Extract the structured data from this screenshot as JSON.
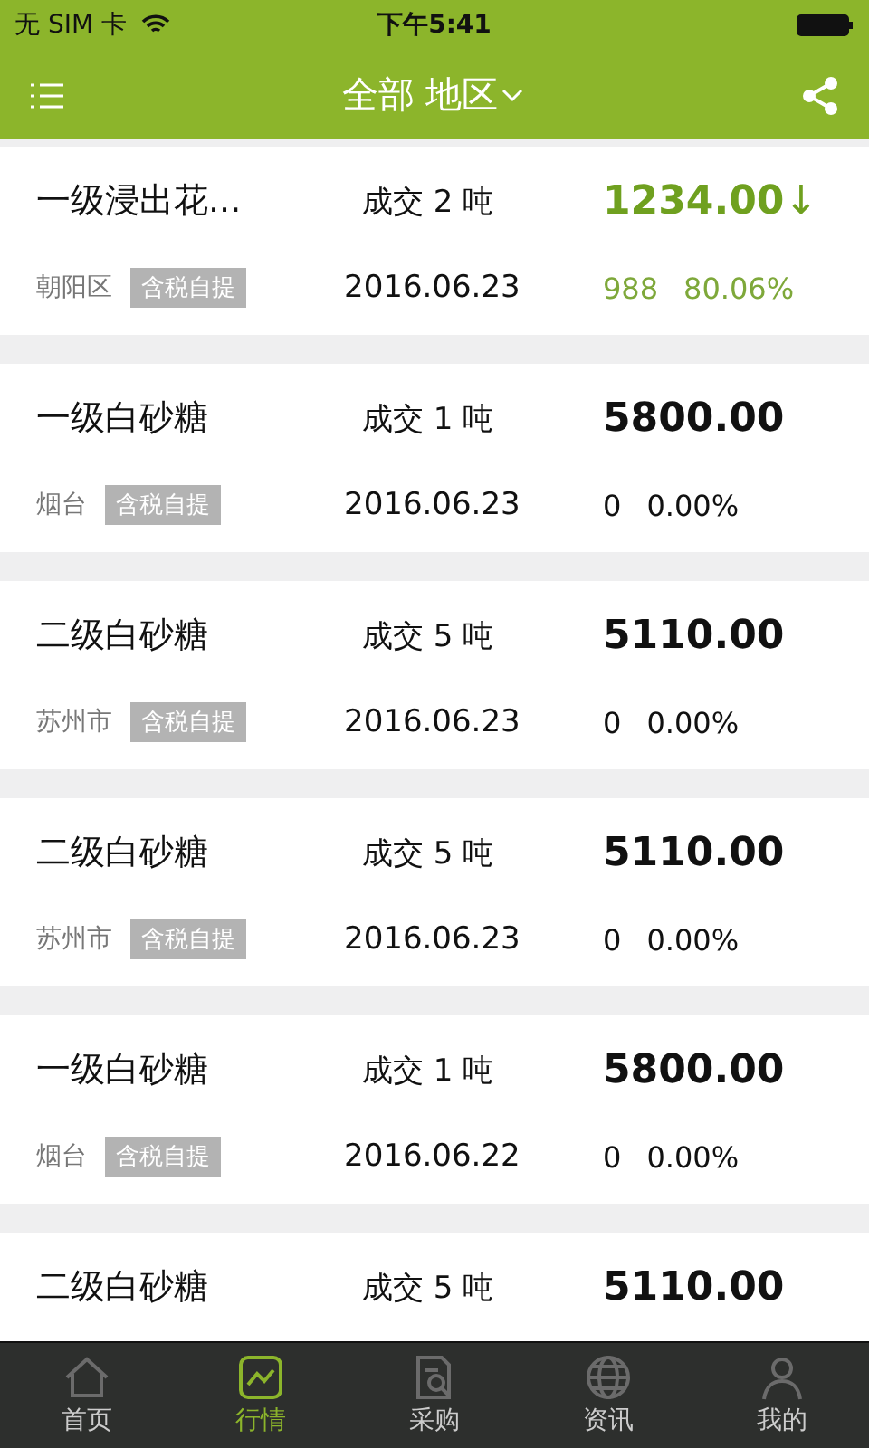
{
  "status_bar": {
    "carrier": "无 SIM 卡",
    "time": "下午5:41"
  },
  "header": {
    "title": "全部 地区"
  },
  "quotes": [
    {
      "name": "一级浸出花...",
      "volume": "成交 2 吨",
      "price": "1234.00",
      "arrow": "↓",
      "kind": "down",
      "region": "朝阳区",
      "tag": "含税自提",
      "date": "2016.06.23",
      "change": "988",
      "percent": "80.06%"
    },
    {
      "name": "一级白砂糖",
      "volume": "成交 1 吨",
      "price": "5800.00",
      "kind": "flat",
      "region": "烟台",
      "tag": "含税自提",
      "date": "2016.06.23",
      "change": "0",
      "percent": "0.00%"
    },
    {
      "name": "二级白砂糖",
      "volume": "成交 5 吨",
      "price": "5110.00",
      "kind": "flat",
      "region": "苏州市",
      "tag": "含税自提",
      "date": "2016.06.23",
      "change": "0",
      "percent": "0.00%"
    },
    {
      "name": "二级白砂糖",
      "volume": "成交 5 吨",
      "price": "5110.00",
      "kind": "flat",
      "region": "苏州市",
      "tag": "含税自提",
      "date": "2016.06.23",
      "change": "0",
      "percent": "0.00%"
    },
    {
      "name": "一级白砂糖",
      "volume": "成交 1 吨",
      "price": "5800.00",
      "kind": "flat",
      "region": "烟台",
      "tag": "含税自提",
      "date": "2016.06.22",
      "change": "0",
      "percent": "0.00%"
    },
    {
      "name": "二级白砂糖",
      "volume": "成交 5 吨",
      "price": "5110.00",
      "kind": "flat"
    }
  ],
  "tab_bar": [
    {
      "label": "首页",
      "kind": "home",
      "selected": false
    },
    {
      "label": "行情",
      "kind": "chart",
      "selected": true
    },
    {
      "label": "采购",
      "kind": "document",
      "selected": false
    },
    {
      "label": "资讯",
      "kind": "globe",
      "selected": false
    },
    {
      "label": "我的",
      "kind": "person",
      "selected": false
    }
  ]
}
